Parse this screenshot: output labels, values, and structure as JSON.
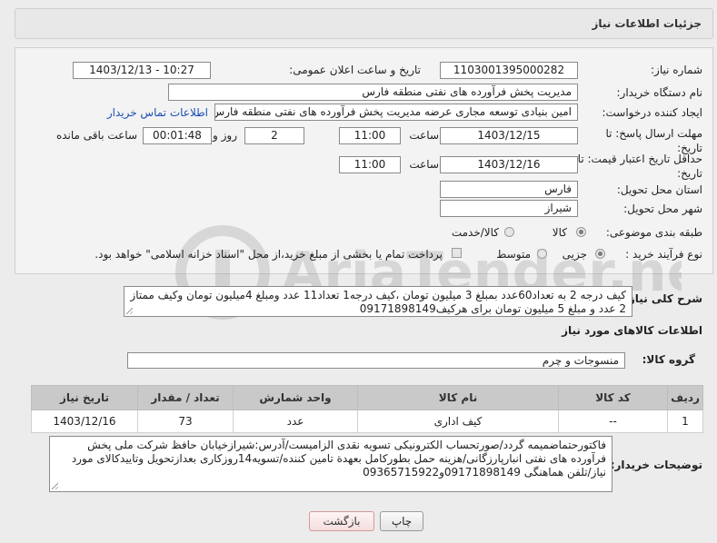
{
  "header": {
    "title": "جزئیات اطلاعات نیاز"
  },
  "fields": {
    "need_number_label": "شماره نیاز:",
    "need_number": "1103001395000282",
    "announce_label": "تاریخ و ساعت اعلان عمومی:",
    "announce_value": "1403/12/13 - 10:27",
    "buyer_org_label": "نام دستگاه خریدار:",
    "buyer_org": "مدیریت پخش فرآورده های نفتی منطقه فارس",
    "creator_label": "ایجاد کننده درخواست:",
    "creator": "امین بنیادی توسعه مجاری عرضه مدیریت پخش فرآورده های نفتی منطقه فارس",
    "contact_link": "اطلاعات تماس خریدار",
    "deadline_label": "مهلت ارسال پاسخ: تا تاریخ:",
    "deadline_date": "1403/12/15",
    "time_label": "ساعت",
    "deadline_time": "11:00",
    "days_value": "2",
    "days_label": "روز و",
    "remaining_time": "00:01:48",
    "remaining_label": "ساعت باقی مانده",
    "validity_label": "حداقل تاریخ اعتبار قیمت: تا تاریخ:",
    "validity_date": "1403/12/16",
    "validity_time": "11:00",
    "province_label": "استان محل تحویل:",
    "province": "فارس",
    "city_label": "شهر محل تحویل:",
    "city": "شیراز",
    "category_label": "طبقه بندی موضوعی:",
    "category_options": [
      "کالا",
      "کالا/خدمت"
    ],
    "process_label": "نوع فرآیند خرید :",
    "process_options": [
      "جزیی",
      "متوسط"
    ],
    "payment_note": "پرداخت تمام یا بخشی از مبلغ خرید،از محل \"اسناد خزانه اسلامی\" خواهد بود."
  },
  "description": {
    "label": "شرح کلی نیاز:",
    "text": "کیف درجه 2 به تعداد60عدد بمبلغ 3 میلیون تومان ،کیف درجه1 تعداد11 عدد ومبلغ 4میلیون تومان وکیف ممتاز 2 عدد و مبلغ 5 میلیون تومان برای هرکیف09171898149"
  },
  "goods": {
    "section_title": "اطلاعات کالاهای مورد نیاز",
    "group_label": "گروه کالا:",
    "group_value": "منسوجات و چرم",
    "columns": [
      "ردیف",
      "کد کالا",
      "نام کالا",
      "واحد شمارش",
      "تعداد / مقدار",
      "تاریخ نیاز"
    ],
    "rows": [
      {
        "row": "1",
        "code": "--",
        "name": "کیف اداری",
        "unit": "عدد",
        "qty": "73",
        "date": "1403/12/16"
      }
    ]
  },
  "buyer_notes": {
    "label": "توضیحات خریدار:",
    "text": "فاکتورحتماضمیمه گردد/صورتحساب الکترونیکی تسویه نقدی الزامیست/آدرس:شیرازخیابان حافظ شرکت ملی پخش فرآورده های نفتی انبارپارزگانی/هزینه حمل بطورکامل بعهدة تامین کننده/تسویه14روزکاری بعدازتحویل وتاییدکالای مورد نیاز/تلفن هماهنگی 09171898149و09365715922"
  },
  "buttons": {
    "print": "چاپ",
    "back": "بازگشت"
  },
  "watermark": {
    "text": "AriaTender.neT"
  }
}
